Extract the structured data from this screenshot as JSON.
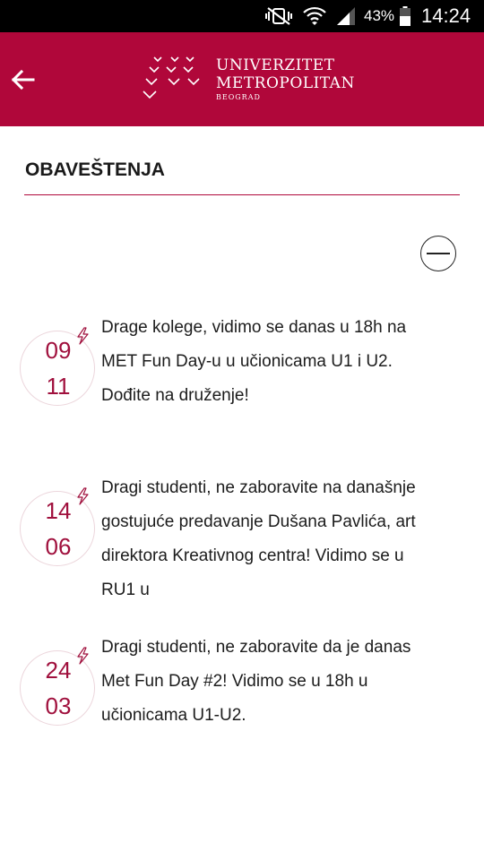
{
  "status_bar": {
    "battery_percent": "43%",
    "time": "14:24",
    "icons": [
      "mute-vibrate-icon",
      "wifi-icon",
      "signal-icon",
      "battery-icon"
    ]
  },
  "app_bar": {
    "logo_line1": "UNIVERZITET",
    "logo_line2": "METROPOLITAN",
    "logo_line3": "BEOGRAD",
    "colors": {
      "primary": "#b0073a",
      "accent": "#a0103d"
    }
  },
  "section": {
    "title": "OBAVEŠTENJA"
  },
  "notices": [
    {
      "day": "09",
      "month": "11",
      "text": "Drage kolege, vidimo se danas u 18h na MET Fun Day-u u učionicama U1 i U2. Dođite na druženje!"
    },
    {
      "day": "14",
      "month": "06",
      "text": "Dragi studenti, ne zaboravite na današnje gostujuće predavanje Dušana Pavlića, art direktora Kreativnog centra! Vidimo se u RU1 u"
    },
    {
      "day": "24",
      "month": "03",
      "text": "Dragi studenti, ne zaboravite da je danas Met Fun Day #2! Vidimo se u 18h u učionicama U1-U2."
    }
  ]
}
